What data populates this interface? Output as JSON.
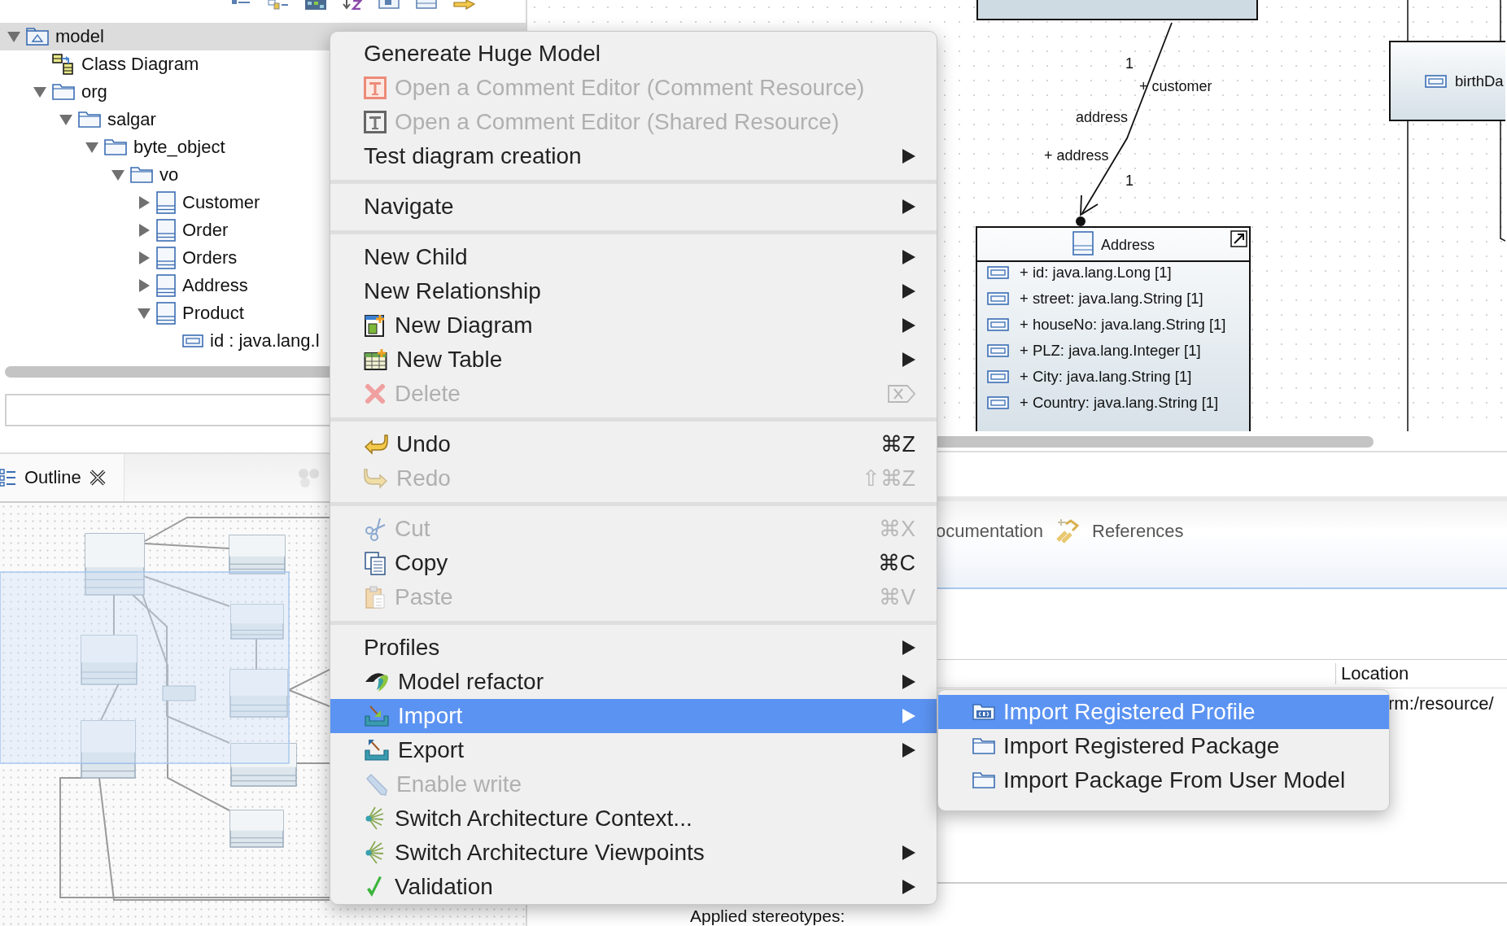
{
  "tree": {
    "items": [
      {
        "label": "model",
        "kind": "model",
        "selected": true,
        "expanded": true,
        "children": [
          {
            "label": "Class Diagram",
            "kind": "diagram",
            "selected": false
          },
          {
            "label": "org",
            "kind": "package",
            "selected": false,
            "expanded": true,
            "children": [
              {
                "label": "salgar",
                "kind": "package",
                "selected": false,
                "expanded": true,
                "children": [
                  {
                    "label": "byte_object",
                    "kind": "package",
                    "selected": false,
                    "expanded": true,
                    "children": [
                      {
                        "label": "vo",
                        "kind": "package",
                        "selected": false,
                        "expanded": true,
                        "children": [
                          {
                            "label": "Customer",
                            "kind": "class",
                            "selected": false,
                            "expanded": false
                          },
                          {
                            "label": "Order",
                            "kind": "class",
                            "selected": false,
                            "expanded": false
                          },
                          {
                            "label": "Orders",
                            "kind": "class",
                            "selected": false,
                            "expanded": false
                          },
                          {
                            "label": "Address",
                            "kind": "class",
                            "selected": false,
                            "expanded": false
                          },
                          {
                            "label": "Product",
                            "kind": "class",
                            "selected": false,
                            "expanded": true,
                            "children": [
                              {
                                "label": "id : java.lang.l",
                                "kind": "property",
                                "selected": false
                              }
                            ]
                          }
                        ]
                      }
                    ]
                  }
                ]
              }
            ]
          }
        ]
      }
    ]
  },
  "outline_tab": {
    "label": "Outline"
  },
  "diagram": {
    "association_labels": [
      {
        "text": "1"
      },
      {
        "text": "+ customer"
      },
      {
        "text": "address"
      },
      {
        "text": "+ address"
      },
      {
        "text": "1"
      }
    ],
    "classes": [
      {
        "name": "Address",
        "attributes": [
          "+ id: java.lang.Long [1]",
          "+ street: java.lang.String [1]",
          "+ houseNo: java.lang.String [1]",
          "+ PLZ: java.lang.Integer [1]",
          "+ City: java.lang.String [1]",
          "+ Country: java.lang.String [1]"
        ]
      },
      {
        "attributes": [
          "birthDa"
        ]
      }
    ]
  },
  "properties": {
    "tabs": [
      {
        "label": "ocumentation"
      },
      {
        "label": "References"
      }
    ],
    "table": {
      "columns": [
        "Location"
      ],
      "rows": [
        [
          "rm:/resource/"
        ]
      ]
    },
    "applied_stereotypes_label": "Applied stereotypes:"
  },
  "context_menu": {
    "sections": [
      {
        "items": [
          {
            "label": "Genereate Huge Model",
            "kind": "plain",
            "disabled": false,
            "selected": false,
            "submenu": false
          },
          {
            "label": "Open a Comment Editor (Comment Resource)",
            "kind": "comment-red",
            "disabled": true,
            "selected": false,
            "submenu": false
          },
          {
            "label": "Open a Comment Editor (Shared Resource)",
            "kind": "comment-gray",
            "disabled": true,
            "selected": false,
            "submenu": false
          },
          {
            "label": "Test diagram creation",
            "kind": "plain",
            "disabled": false,
            "selected": false,
            "submenu": true
          }
        ]
      },
      {
        "items": [
          {
            "label": "Navigate",
            "kind": "plain",
            "disabled": false,
            "selected": false,
            "submenu": true
          }
        ]
      },
      {
        "items": [
          {
            "label": "New Child",
            "kind": "plain",
            "disabled": false,
            "selected": false,
            "submenu": true
          },
          {
            "label": "New Relationship",
            "kind": "plain",
            "disabled": false,
            "selected": false,
            "submenu": true
          },
          {
            "label": "New Diagram",
            "kind": "diagram",
            "disabled": false,
            "selected": false,
            "submenu": true
          },
          {
            "label": "New Table",
            "kind": "table",
            "disabled": false,
            "selected": false,
            "submenu": true
          },
          {
            "label": "Delete",
            "kind": "delete",
            "disabled": true,
            "selected": false,
            "submenu": false,
            "key_icon": true
          }
        ]
      },
      {
        "items": [
          {
            "label": "Undo",
            "kind": "undo",
            "disabled": false,
            "selected": false,
            "submenu": false,
            "shortcut": "⌘Z"
          },
          {
            "label": "Redo",
            "kind": "redo",
            "disabled": true,
            "selected": false,
            "submenu": false,
            "shortcut": "⇧⌘Z"
          }
        ]
      },
      {
        "items": [
          {
            "label": "Cut",
            "kind": "cut",
            "disabled": true,
            "selected": false,
            "submenu": false,
            "shortcut": "⌘X"
          },
          {
            "label": "Copy",
            "kind": "copy",
            "disabled": false,
            "selected": false,
            "submenu": false,
            "shortcut": "⌘C"
          },
          {
            "label": "Paste",
            "kind": "paste",
            "disabled": true,
            "selected": false,
            "submenu": false,
            "shortcut": "⌘V"
          }
        ]
      },
      {
        "items": [
          {
            "label": "Profiles",
            "kind": "plain",
            "disabled": false,
            "selected": false,
            "submenu": true
          },
          {
            "label": "Model refactor",
            "kind": "refactor",
            "disabled": false,
            "selected": false,
            "submenu": true
          },
          {
            "label": "Import",
            "kind": "import",
            "disabled": false,
            "selected": true,
            "submenu": true
          },
          {
            "label": "Export",
            "kind": "export",
            "disabled": false,
            "selected": false,
            "submenu": true
          },
          {
            "label": "Enable write",
            "kind": "pencil",
            "disabled": true,
            "selected": false,
            "submenu": false
          },
          {
            "label": "Switch Architecture Context...",
            "kind": "switch",
            "disabled": false,
            "selected": false,
            "submenu": false
          },
          {
            "label": "Switch Architecture Viewpoints",
            "kind": "switch",
            "disabled": false,
            "selected": false,
            "submenu": true
          },
          {
            "label": "Validation",
            "kind": "check",
            "disabled": false,
            "selected": false,
            "submenu": true
          }
        ]
      }
    ]
  },
  "submenu": {
    "items": [
      {
        "label": "Import Registered Profile",
        "kind": "profile",
        "selected": true
      },
      {
        "label": "Import Registered Package",
        "kind": "package",
        "selected": false
      },
      {
        "label": "Import Package From User Model",
        "kind": "package",
        "selected": false
      }
    ]
  }
}
